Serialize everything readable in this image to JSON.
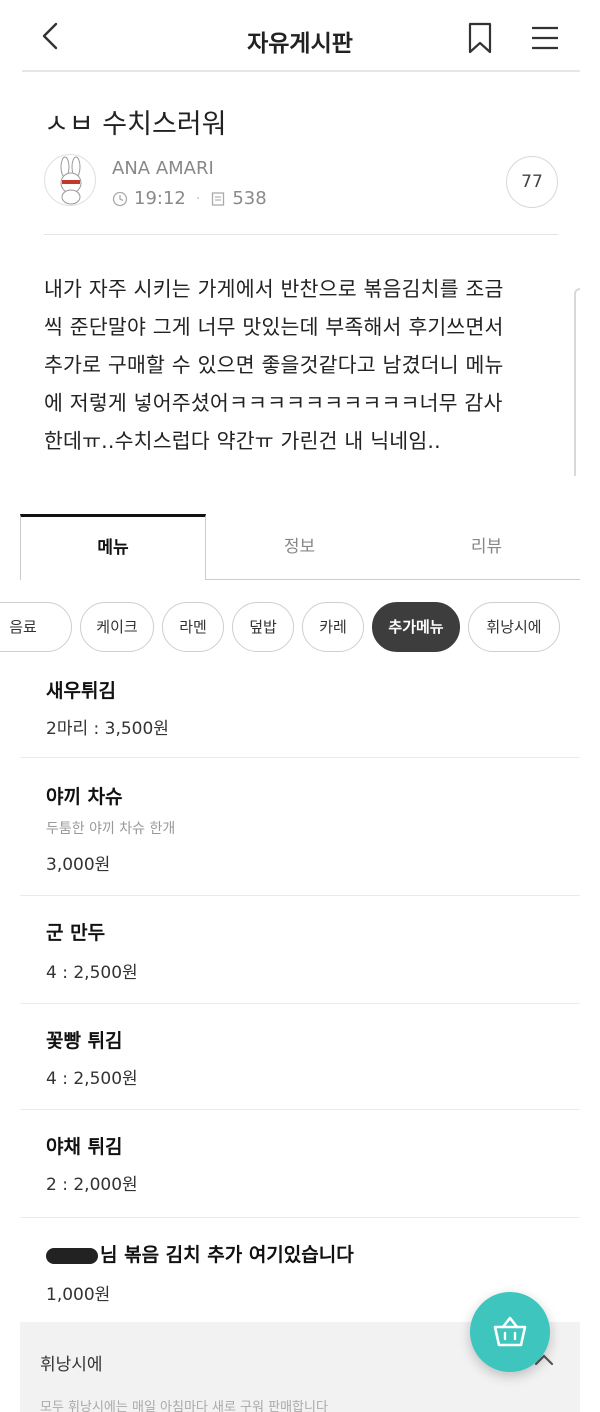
{
  "header": {
    "title": "자유게시판"
  },
  "post": {
    "title": "ㅅㅂ 수치스러워",
    "author": "ANA AMARI",
    "time": "19:12",
    "views": "538",
    "comments": "77",
    "body": [
      "내가 자주 시키는 가게에서 반찬으로 볶음김치를 조금",
      "씩 준단말야 그게 너무 맛있는데 부족해서 후기쓰면서",
      "추가로 구매할 수 있으면 좋을것같다고 남겼더니 메뉴",
      "에 저렇게 넣어주셨어ㅋㅋㅋㅋㅋㅋㅋㅋㅋㅋ너무 감사",
      "한데ㅠ..수치스럽다 약간ㅠ 가린건 내 닉네임.."
    ]
  },
  "tabs": [
    {
      "label": "메뉴",
      "active": true
    },
    {
      "label": "정보",
      "active": false
    },
    {
      "label": "리뷰",
      "active": false
    }
  ],
  "categories": [
    {
      "label": "음료",
      "active": false
    },
    {
      "label": "케이크",
      "active": false
    },
    {
      "label": "라멘",
      "active": false
    },
    {
      "label": "덮밥",
      "active": false
    },
    {
      "label": "카레",
      "active": false
    },
    {
      "label": "추가메뉴",
      "active": true
    },
    {
      "label": "휘낭시에",
      "active": false
    }
  ],
  "menu_items": [
    {
      "name": "새우튀김",
      "desc": "",
      "price": "2마리 : 3,500원"
    },
    {
      "name": "야끼 차슈",
      "desc": "두툼한 야끼 차슈 한개",
      "price": "3,000원"
    },
    {
      "name": "군 만두",
      "desc": "",
      "price": "4 : 2,500원"
    },
    {
      "name": "꽃빵 튀김",
      "desc": "",
      "price": "4 : 2,500원"
    },
    {
      "name": "야채 튀김",
      "desc": "",
      "price": "2 : 2,000원"
    },
    {
      "name": "님 볶음 김치 추가 여기있습니다",
      "desc": "",
      "price": "1,000원"
    }
  ],
  "footer_section": {
    "title": "휘낭시에",
    "subtitle": "모두 휘낭시에는 매일 아침마다 새로 구워 판매합니다"
  },
  "colors": {
    "accent": "#3dc5be",
    "chip_active": "#3d3d3d"
  },
  "icons": [
    "back-arrow-icon",
    "bookmark-icon",
    "hamburger-menu-icon",
    "clock-icon",
    "document-icon",
    "chevron-up-icon",
    "basket-icon"
  ]
}
